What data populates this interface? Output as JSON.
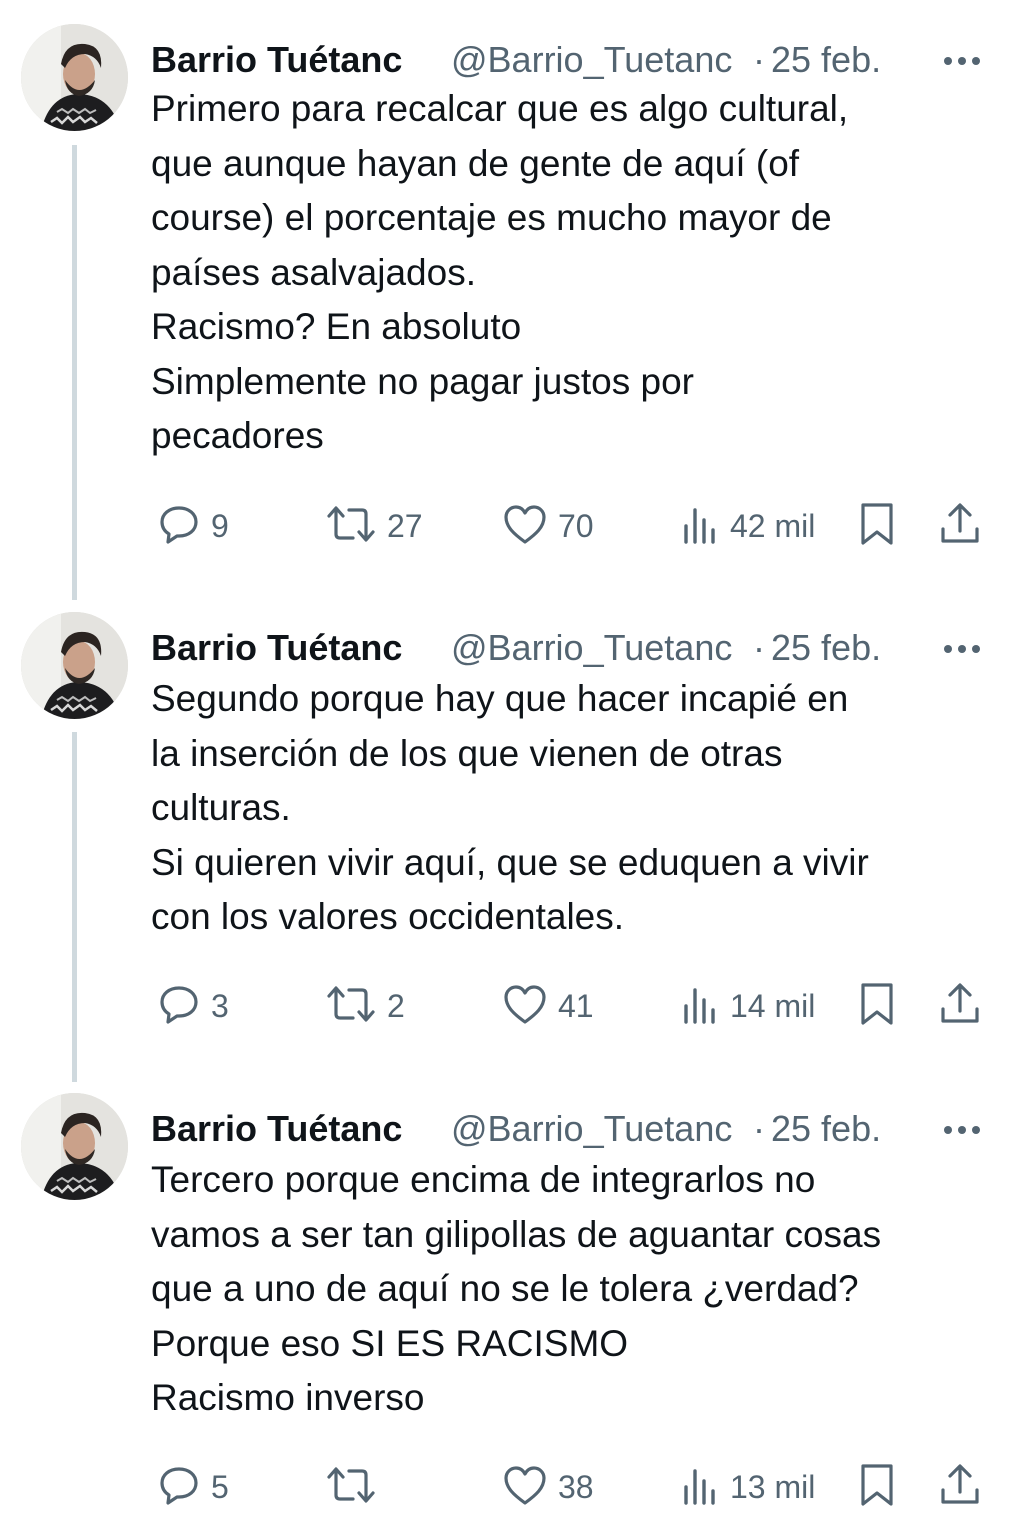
{
  "tweets": [
    {
      "name": "Barrio Tuétanc",
      "handle": "@Barrio_Tuetanc",
      "separator": "·",
      "date": "25 feb.",
      "text": "Primero para recalcar que es algo cultural,\nque aunque hayan de gente de aquí (of\ncourse) el porcentaje es mucho mayor de\npaíses asalvajados.\nRacismo? En absoluto\nSimplemente no pagar justos por\npecadores",
      "replies": "9",
      "retweets": "27",
      "likes": "70",
      "views": "42 mil"
    },
    {
      "name": "Barrio Tuétanc",
      "handle": "@Barrio_Tuetanc",
      "separator": "·",
      "date": "25 feb.",
      "text": "Segundo porque hay que hacer incapié en\nla inserción de los que vienen de otras\nculturas.\nSi quieren vivir aquí, que se eduquen a vivir\ncon los valores occidentales.",
      "replies": "3",
      "retweets": "2",
      "likes": "41",
      "views": "14 mil"
    },
    {
      "name": "Barrio Tuétanc",
      "handle": "@Barrio_Tuetanc",
      "separator": "·",
      "date": "25 feb.",
      "text": "Tercero porque encima de integrarlos no\nvamos a ser tan gilipollas de aguantar cosas\nque a uno de aquí no se le tolera ¿verdad?\nPorque eso SI ES RACISMO\nRacismo inverso",
      "replies": "5",
      "retweets": "",
      "likes": "38",
      "views": "13 mil"
    }
  ],
  "colors": {
    "text": "#0f1419",
    "secondary": "#536471",
    "thread_line": "#cfd9de"
  },
  "icons": [
    "avatar",
    "more-icon",
    "reply-icon",
    "retweet-icon",
    "like-icon",
    "views-icon",
    "bookmark-icon",
    "share-icon"
  ]
}
